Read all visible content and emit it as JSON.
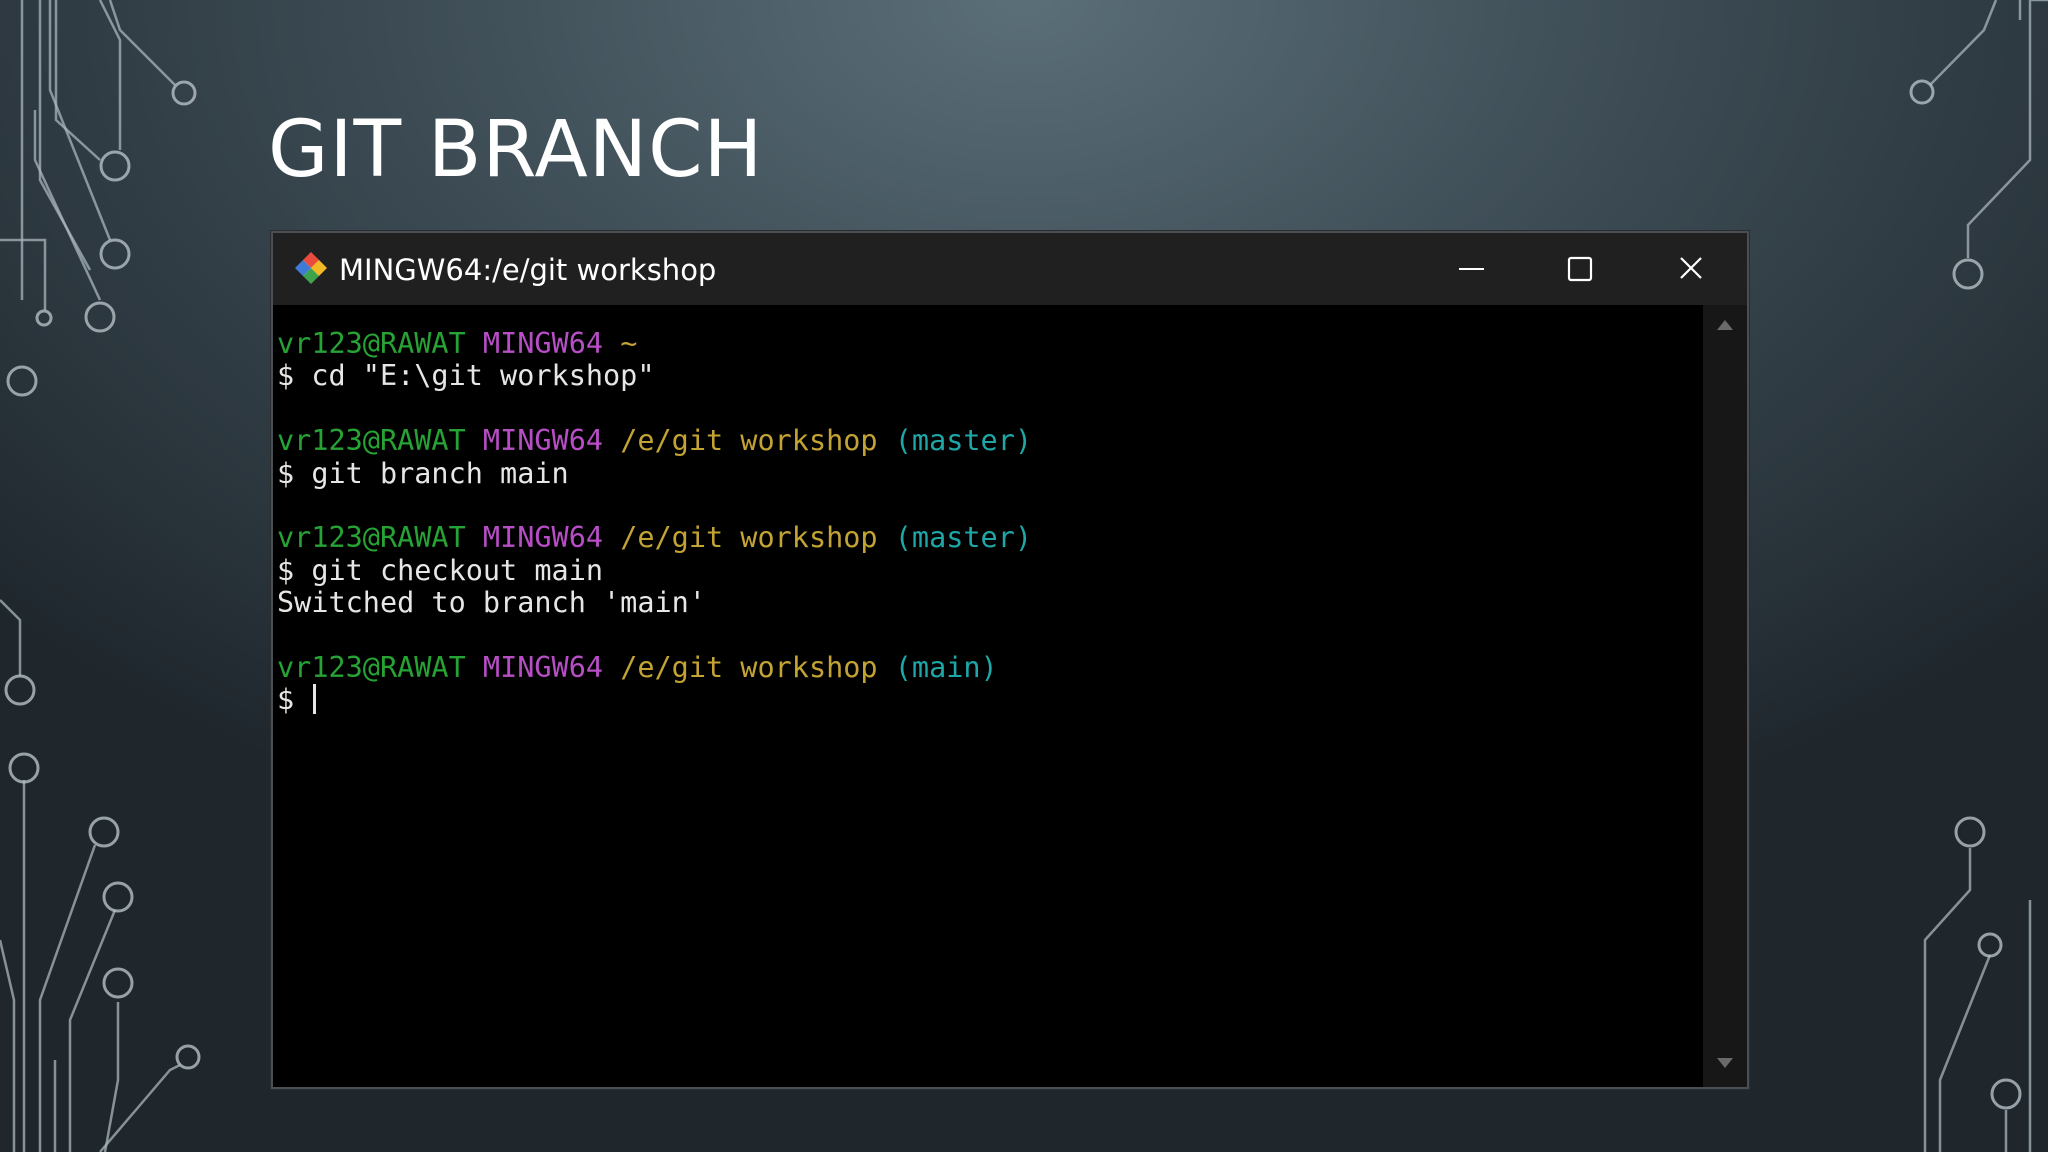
{
  "slide": {
    "title": "GIT BRANCH"
  },
  "window": {
    "title": "MINGW64:/e/git workshop",
    "icon": "git-logo-icon",
    "controls": {
      "minimize_icon": "minimize-icon",
      "maximize_icon": "maximize-icon",
      "close_icon": "close-icon"
    }
  },
  "terminal": {
    "colors": {
      "user": "#26a334",
      "host": "#b74ec6",
      "path": "#c2a334",
      "branch": "#1fa6a6",
      "text": "#e6e6e6",
      "background": "#000000"
    },
    "blocks": [
      {
        "prompt": {
          "user": "vr123@RAWAT",
          "host": "MINGW64",
          "path": "~",
          "branch": ""
        },
        "command": "$ cd \"E:\\git workshop\"",
        "output": []
      },
      {
        "prompt": {
          "user": "vr123@RAWAT",
          "host": "MINGW64",
          "path": "/e/git workshop",
          "branch": "(master)"
        },
        "command": "$ git branch main",
        "output": []
      },
      {
        "prompt": {
          "user": "vr123@RAWAT",
          "host": "MINGW64",
          "path": "/e/git workshop",
          "branch": "(master)"
        },
        "command": "$ git checkout main",
        "output": [
          "Switched to branch 'main'"
        ]
      },
      {
        "prompt": {
          "user": "vr123@RAWAT",
          "host": "MINGW64",
          "path": "/e/git workshop",
          "branch": "(main)"
        },
        "command": "$ ",
        "output": []
      }
    ]
  }
}
